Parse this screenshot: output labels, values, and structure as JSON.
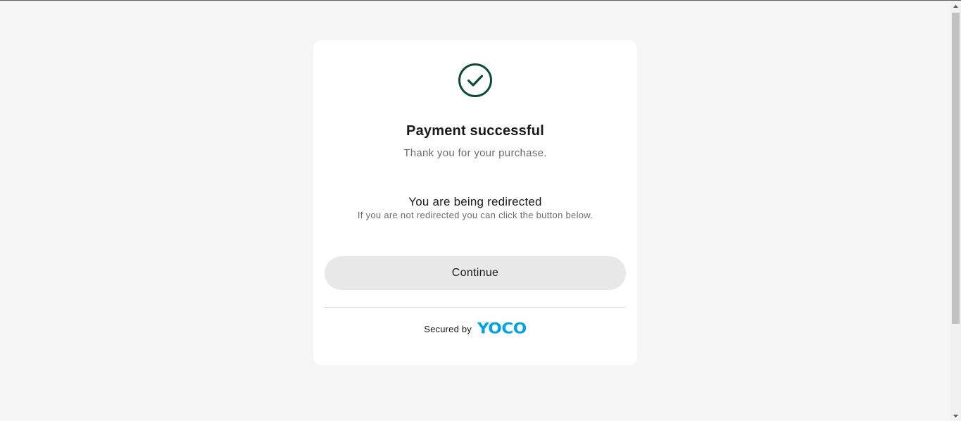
{
  "card": {
    "title": "Payment successful",
    "subtitle": "Thank you for your purchase.",
    "redirect_heading": "You are being redirected",
    "redirect_note": "If you are not redirected you can click the button below.",
    "continue_label": "Continue",
    "secured_label": "Secured by",
    "brand_logo_text": "YOCO",
    "icons": {
      "success": "check-circle-icon"
    }
  },
  "colors": {
    "page_background": "#f5f5f5",
    "card_background": "#ffffff",
    "success_icon": "#0d4a3a",
    "brand": "#00a3e0",
    "button_background": "#e8e8e8",
    "text_primary": "#1a1a1a",
    "text_secondary": "#6b6b6b"
  }
}
